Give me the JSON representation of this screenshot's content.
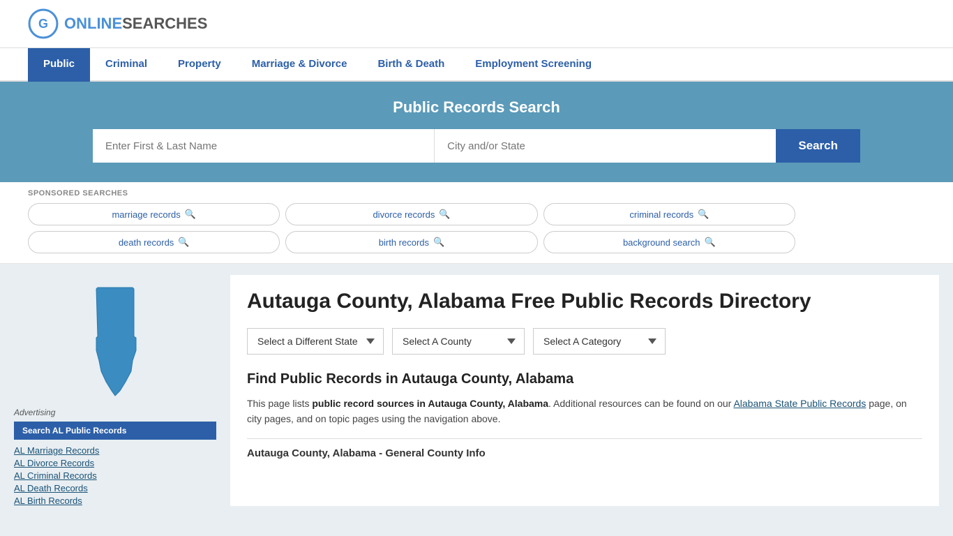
{
  "logo": {
    "text_online": "ONLINE",
    "text_searches": "SEARCHES",
    "icon_label": "G-logo"
  },
  "nav": {
    "items": [
      {
        "label": "Public",
        "active": true
      },
      {
        "label": "Criminal",
        "active": false
      },
      {
        "label": "Property",
        "active": false
      },
      {
        "label": "Marriage & Divorce",
        "active": false
      },
      {
        "label": "Birth & Death",
        "active": false
      },
      {
        "label": "Employment Screening",
        "active": false
      }
    ]
  },
  "hero": {
    "title": "Public Records Search",
    "name_placeholder": "Enter First & Last Name",
    "location_placeholder": "City and/or State",
    "search_btn": "Search"
  },
  "sponsored": {
    "label": "SPONSORED SEARCHES",
    "items": [
      {
        "label": "marriage records"
      },
      {
        "label": "divorce records"
      },
      {
        "label": "criminal records"
      },
      {
        "label": "death records"
      },
      {
        "label": "birth records"
      },
      {
        "label": "background search"
      }
    ]
  },
  "page": {
    "title": "Autauga County, Alabama Free Public Records Directory",
    "dropdowns": {
      "state": {
        "label": "Select a Different State"
      },
      "county": {
        "label": "Select A County"
      },
      "category": {
        "label": "Select A Category"
      }
    },
    "find_title": "Find Public Records in Autauga County, Alabama",
    "find_description_1": "This page lists ",
    "find_description_bold": "public record sources in Autauga County, Alabama",
    "find_description_2": ". Additional resources can be found on our ",
    "find_description_link": "Alabama State Public Records",
    "find_description_3": " page, on city pages, and on topic pages using the navigation above.",
    "county_info_header": "Autauga County, Alabama - General County Info"
  },
  "advertising": {
    "label": "Advertising",
    "btn_label": "Search AL Public Records",
    "links": [
      "AL Marriage Records",
      "AL Divorce Records",
      "AL Criminal Records",
      "AL Death Records",
      "AL Birth Records"
    ]
  },
  "colors": {
    "blue_primary": "#2c5fa8",
    "blue_hero": "#5b9ab8",
    "map_fill": "#3a8cc1"
  }
}
